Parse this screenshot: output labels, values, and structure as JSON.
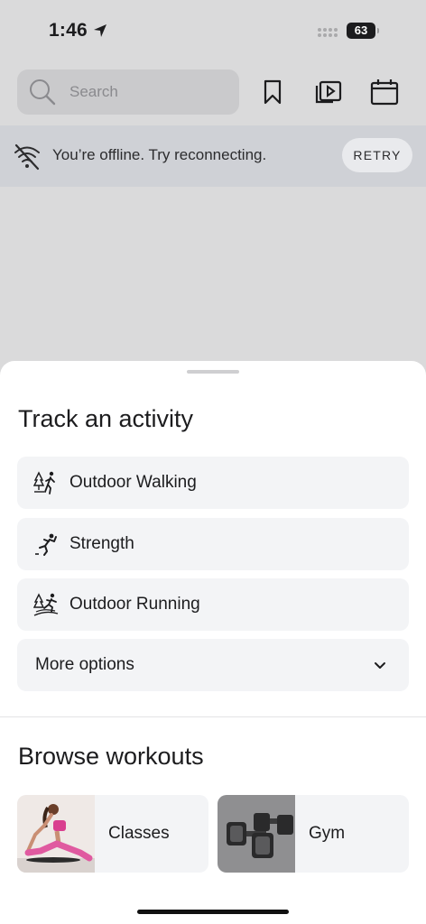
{
  "status_bar": {
    "time": "1:46",
    "battery": "63"
  },
  "toolbar": {
    "search_placeholder": "Search",
    "icons": [
      "search-icon",
      "bookmark-icon",
      "video-library-icon",
      "calendar-icon"
    ]
  },
  "offline_banner": {
    "message": "You’re offline. Try reconnecting.",
    "retry_label": "RETRY",
    "icon": "wifi-off-icon"
  },
  "track_activity": {
    "title": "Track an activity",
    "items": [
      {
        "label": "Outdoor Walking",
        "icon": "outdoor-walking-icon"
      },
      {
        "label": "Strength",
        "icon": "strength-icon"
      },
      {
        "label": "Outdoor Running",
        "icon": "outdoor-running-icon"
      }
    ],
    "more_options_label": "More options"
  },
  "browse_workouts": {
    "title": "Browse workouts",
    "cards": [
      {
        "label": "Classes",
        "image": "yoga-class-photo"
      },
      {
        "label": "Gym",
        "image": "dumbbells-photo"
      }
    ]
  },
  "colors": {
    "background": "#dadadb",
    "banner": "#cfd1d6",
    "row": "#f3f4f6",
    "text": "#1c1c1e"
  }
}
